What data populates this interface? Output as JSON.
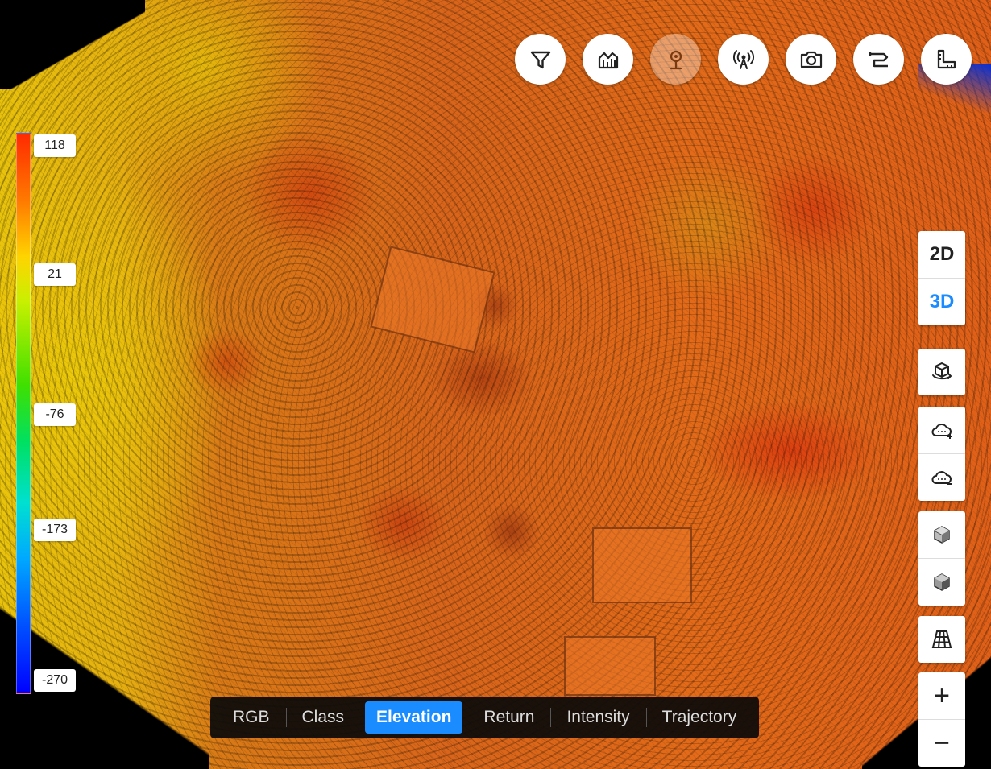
{
  "legend": {
    "labels": [
      "118",
      "21",
      "-76",
      "-173",
      "-270"
    ]
  },
  "toolbar": {
    "buttons": [
      {
        "name": "filter",
        "icon": "filter-icon",
        "enabled": true
      },
      {
        "name": "profile",
        "icon": "area-chart-icon",
        "enabled": true
      },
      {
        "name": "location",
        "icon": "map-pin-icon",
        "enabled": false
      },
      {
        "name": "broadcast",
        "icon": "antenna-icon",
        "enabled": true
      },
      {
        "name": "screenshot",
        "icon": "camera-icon",
        "enabled": true
      },
      {
        "name": "path",
        "icon": "route-icon",
        "enabled": true
      },
      {
        "name": "measure",
        "icon": "ruler-icon",
        "enabled": true
      }
    ]
  },
  "view_mode": {
    "two_d": "2D",
    "three_d": "3D",
    "active": "3D"
  },
  "zoom": {
    "in": "+",
    "out": "−"
  },
  "tabs": {
    "items": [
      "RGB",
      "Class",
      "Elevation",
      "Return",
      "Intensity",
      "Trajectory"
    ],
    "active": "Elevation"
  },
  "colors": {
    "accent": "#1a8cff",
    "legend_top": "#ff2a00",
    "legend_bottom": "#0000ff"
  }
}
